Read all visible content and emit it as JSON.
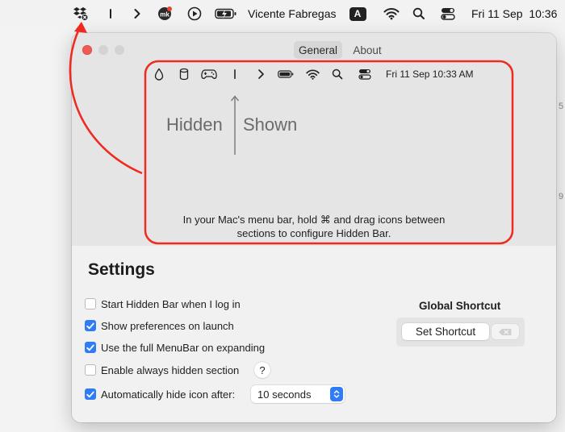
{
  "menubar": {
    "user_name": "Vicente Fabregas",
    "input_source": "A",
    "datetime": "Fri 11 Sep  10:36",
    "icons": [
      "dropbox-icon",
      "separator-icon",
      "chevron-right-icon",
      "mk-app-icon",
      "play-circle-icon",
      "battery-charging-icon",
      "input-source-icon",
      "wifi-icon",
      "search-icon",
      "control-center-icon"
    ]
  },
  "window": {
    "tabs": [
      {
        "label": "General",
        "active": true
      },
      {
        "label": "About",
        "active": false
      }
    ],
    "preview": {
      "icons": [
        "drop-icon",
        "cylinder-icon",
        "gamepad-icon",
        "separator-icon",
        "chevron-right-icon",
        "battery-icon",
        "wifi-icon",
        "search-icon",
        "control-center-icon"
      ],
      "datetime": "Fri 11 Sep 10:33 AM",
      "hidden_label": "Hidden",
      "shown_label": "Shown",
      "instructions": "In your Mac's menu bar, hold ⌘ and drag icons between sections to configure Hidden Bar."
    },
    "settings": {
      "title": "Settings",
      "options": [
        {
          "label": "Start Hidden Bar when I log in",
          "checked": false
        },
        {
          "label": "Show preferences on launch",
          "checked": true
        },
        {
          "label": "Use the full MenuBar on expanding",
          "checked": true
        },
        {
          "label": "Enable always hidden section",
          "checked": false
        },
        {
          "label": "Automatically hide icon after:",
          "checked": true
        }
      ],
      "help_label": "?",
      "autohide_value": "10 seconds",
      "global_shortcut": {
        "title": "Global Shortcut",
        "button_label": "Set Shortcut"
      }
    }
  },
  "colors": {
    "accent": "#2f7cf6",
    "annotation": "#ef2a1f",
    "close": "#ee5b52"
  }
}
